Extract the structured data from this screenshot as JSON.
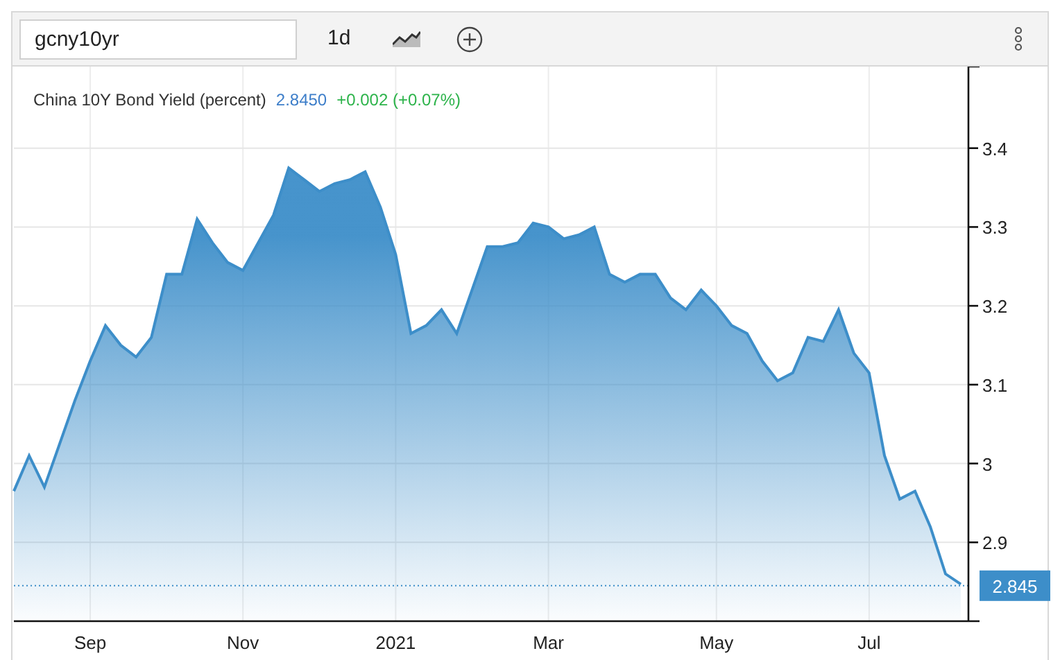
{
  "toolbar": {
    "symbol": "gcny10yr",
    "interval": "1d"
  },
  "quote": {
    "name": "China 10Y Bond Yield (percent)",
    "price": "2.8450",
    "change": "+0.002 (+0.07%)"
  },
  "chart_data": {
    "type": "area",
    "grid": true,
    "ylim": [
      2.8,
      3.5035
    ],
    "categories": [
      null,
      null,
      null,
      null,
      null,
      "Sep",
      null,
      null,
      null,
      null,
      null,
      null,
      null,
      null,
      null,
      "Nov",
      null,
      null,
      null,
      null,
      null,
      null,
      null,
      null,
      null,
      "2021",
      null,
      null,
      null,
      null,
      null,
      null,
      null,
      null,
      null,
      "Mar",
      null,
      null,
      null,
      null,
      null,
      null,
      null,
      null,
      null,
      null,
      "May",
      null,
      null,
      null,
      null,
      null,
      null,
      null,
      null,
      null,
      "Jul",
      null,
      null,
      null,
      null,
      null,
      null
    ],
    "yticks": [
      {
        "value": 3.4,
        "label": "3.4"
      },
      {
        "value": 3.3,
        "label": "3.3"
      },
      {
        "value": 3.2,
        "label": "3.2"
      },
      {
        "value": 3.1,
        "label": "3.1"
      },
      {
        "value": 3.0,
        "label": "3"
      },
      {
        "value": 2.9,
        "label": "2.9"
      }
    ],
    "series": [
      {
        "color": "#3d8ec9",
        "values": [
          2.965,
          3.01,
          2.97,
          3.025,
          3.08,
          3.13,
          3.175,
          3.15,
          3.135,
          3.16,
          3.24,
          3.24,
          3.31,
          3.28,
          3.255,
          3.245,
          3.28,
          3.315,
          3.375,
          3.36,
          3.345,
          3.355,
          3.36,
          3.37,
          3.325,
          3.265,
          3.165,
          3.175,
          3.195,
          3.165,
          3.22,
          3.275,
          3.275,
          3.28,
          3.305,
          3.3,
          3.285,
          3.29,
          3.3,
          3.24,
          3.23,
          3.24,
          3.24,
          3.21,
          3.195,
          3.22,
          3.2,
          3.175,
          3.165,
          3.13,
          3.105,
          3.115,
          3.16,
          3.155,
          3.195,
          3.14,
          3.115,
          3.01,
          2.955,
          2.965,
          2.92,
          2.86,
          2.847
        ]
      }
    ],
    "ref_lines": [
      {
        "axis": "y",
        "value": 2.845,
        "label": "2.845",
        "color": "#3d8ec9"
      }
    ]
  }
}
